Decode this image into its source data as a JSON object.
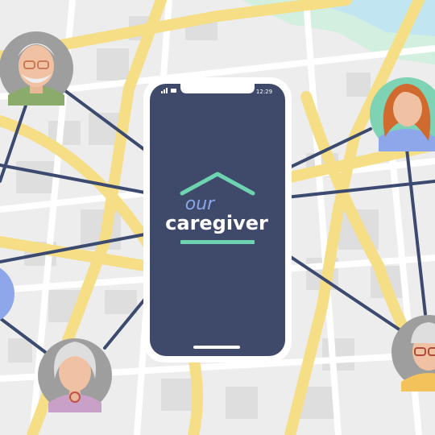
{
  "phone": {
    "status_time": "12:29"
  },
  "app": {
    "logo_word_1": "our",
    "logo_word_2": "caregiver",
    "brand_color": "#6dd3b0",
    "screen_color": "#3f4a6b",
    "logo_accent": "#8aa6e8"
  },
  "map": {
    "road_color": "#f6e08a",
    "block_color": "#e2e2e2",
    "park_color": "#cfeedd",
    "water_color": "#bfe3f0",
    "link_color": "#3b4a6e"
  },
  "people": [
    {
      "icon": "elderly-man-glasses-avatar",
      "bg": "#9e9e9e"
    },
    {
      "icon": "red-haired-woman-avatar",
      "bg": "#7dd3b3"
    },
    {
      "icon": "elderly-woman-avatar",
      "bg": "#9e9e9e"
    },
    {
      "icon": "elderly-man-cap-avatar",
      "bg": "#9e9e9e"
    },
    {
      "icon": "partial-avatar",
      "bg": "#8ea7ea"
    }
  ]
}
